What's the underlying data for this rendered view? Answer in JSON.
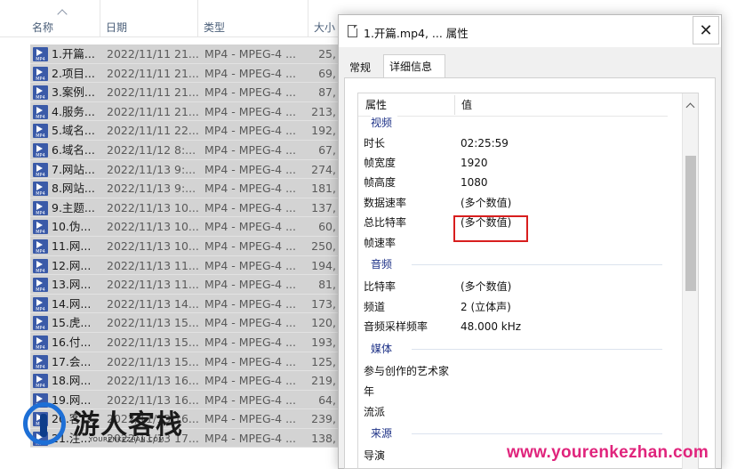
{
  "explorer": {
    "columns": {
      "name": "名称",
      "date": "日期",
      "type": "类型",
      "size": "大小"
    },
    "files": [
      {
        "name": "1.开篇...",
        "date": "2022/11/11 21...",
        "type": "MP4 - MPEG-4 ...",
        "size": "25,"
      },
      {
        "name": "2.项目...",
        "date": "2022/11/11 21...",
        "type": "MP4 - MPEG-4 ...",
        "size": "69,"
      },
      {
        "name": "3.案例...",
        "date": "2022/11/11 21...",
        "type": "MP4 - MPEG-4 ...",
        "size": "87,"
      },
      {
        "name": "4.服务...",
        "date": "2022/11/11 21...",
        "type": "MP4 - MPEG-4 ...",
        "size": "213,"
      },
      {
        "name": "5.域名...",
        "date": "2022/11/11 22...",
        "type": "MP4 - MPEG-4 ...",
        "size": "192,"
      },
      {
        "name": "6.域名...",
        "date": "2022/11/12 8:...",
        "type": "MP4 - MPEG-4 ...",
        "size": "67,"
      },
      {
        "name": "7.网站...",
        "date": "2022/11/13 9:...",
        "type": "MP4 - MPEG-4 ...",
        "size": "274,"
      },
      {
        "name": "8.网站...",
        "date": "2022/11/13 9:...",
        "type": "MP4 - MPEG-4 ...",
        "size": "181,"
      },
      {
        "name": "9.主题...",
        "date": "2022/11/13 10...",
        "type": "MP4 - MPEG-4 ...",
        "size": "137,"
      },
      {
        "name": "10.伪...",
        "date": "2022/11/13 10...",
        "type": "MP4 - MPEG-4 ...",
        "size": "60,"
      },
      {
        "name": "11.网...",
        "date": "2022/11/13 10...",
        "type": "MP4 - MPEG-4 ...",
        "size": "250,"
      },
      {
        "name": "12.网...",
        "date": "2022/11/13 11...",
        "type": "MP4 - MPEG-4 ...",
        "size": "194,"
      },
      {
        "name": "13.网...",
        "date": "2022/11/13 11...",
        "type": "MP4 - MPEG-4 ...",
        "size": "81,"
      },
      {
        "name": "14.网...",
        "date": "2022/11/13 14...",
        "type": "MP4 - MPEG-4 ...",
        "size": "173,"
      },
      {
        "name": "15.虎...",
        "date": "2022/11/13 15...",
        "type": "MP4 - MPEG-4 ...",
        "size": "120,"
      },
      {
        "name": "16.付...",
        "date": "2022/11/13 15...",
        "type": "MP4 - MPEG-4 ...",
        "size": "193,"
      },
      {
        "name": "17.会...",
        "date": "2022/11/13 15...",
        "type": "MP4 - MPEG-4 ...",
        "size": "125,"
      },
      {
        "name": "18.网...",
        "date": "2022/11/13 16...",
        "type": "MP4 - MPEG-4 ...",
        "size": "219,"
      },
      {
        "name": "19.网...",
        "date": "2022/11/13 16...",
        "type": "MP4 - MPEG-4 ...",
        "size": "64,"
      },
      {
        "name": "20.客...",
        "date": "2022/11/13 16...",
        "type": "MP4 - MPEG-4 ...",
        "size": "239,"
      },
      {
        "name": "21.注...",
        "date": "2022/11/13 17...",
        "type": "MP4 - MPEG-4 ...",
        "size": "138,"
      }
    ]
  },
  "dialog": {
    "title": "1.开篇.mp4, ... 属性",
    "close_glyph": "✕",
    "tabs": {
      "general": "常规",
      "details": "详细信息"
    },
    "list_header": {
      "property": "属性",
      "value": "值"
    },
    "groups": {
      "video": "视频",
      "audio": "音频",
      "media": "媒体",
      "origin": "来源"
    },
    "video": {
      "duration_label": "时长",
      "duration_value": "02:25:59",
      "width_label": "帧宽度",
      "width_value": "1920",
      "height_label": "帧高度",
      "height_value": "1080",
      "data_rate_label": "数据速率",
      "data_rate_value": "(多个数值)",
      "total_bitrate_label": "总比特率",
      "total_bitrate_value": "(多个数值)",
      "frame_rate_label": "帧速率",
      "frame_rate_value": ""
    },
    "audio": {
      "bitrate_label": "比特率",
      "bitrate_value": "(多个数值)",
      "channels_label": "频道",
      "channels_value": "2 (立体声)",
      "sample_rate_label": "音频采样频率",
      "sample_rate_value": "48.000 kHz"
    },
    "media": {
      "artists_label": "参与创作的艺术家",
      "year_label": "年",
      "genre_label": "流派"
    },
    "origin": {
      "director_label": "导演"
    }
  },
  "watermark": {
    "name": "游人客栈",
    "sub": "YOURENKEZHAN.COM",
    "url": "www.yourenkezhan.com"
  },
  "colors": {
    "highlight": "#d81e1e",
    "group_text": "#1e3287",
    "watermark_url": "#e0247c"
  }
}
